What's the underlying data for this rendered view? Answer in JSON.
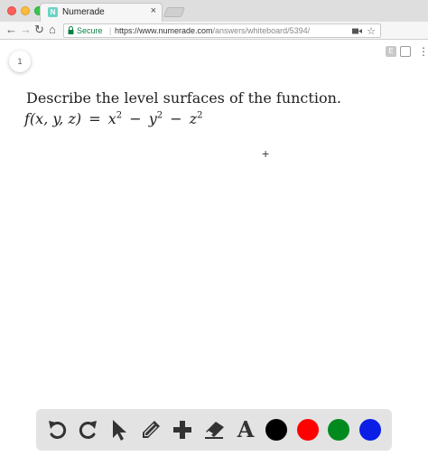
{
  "browser": {
    "tab_title": "Numerade",
    "favicon_letter": "N",
    "tab_close": "×",
    "secure_label": "Secure",
    "separator": "|",
    "url_base": "https://www.numerade.com",
    "url_path": "/answers/whiteboard/5394/",
    "nav_icons": [
      "back-arrow-icon",
      "forward-arrow-icon",
      "reload-icon",
      "home-icon"
    ],
    "back_glyph": "←",
    "forward_glyph": "→",
    "reload_glyph": "↻",
    "home_glyph": "⌂",
    "star_glyph": "☆",
    "menu_glyph": "⋮",
    "ext_letter": "E"
  },
  "whiteboard": {
    "page_number": "1",
    "question_text": "Describe the level surfaces of the function.",
    "formula": {
      "lhs": "f(x, y, z)",
      "eq": "=",
      "t1": "x",
      "t2": "y",
      "t3": "z",
      "exp": "2",
      "minus": "−"
    },
    "crosshair": "+"
  },
  "draw_toolbar": {
    "tools": [
      "undo-icon",
      "redo-icon",
      "pointer-icon",
      "pencil-icon",
      "plus-icon",
      "eraser-icon",
      "text-icon"
    ],
    "text_tool_label": "A",
    "colors": {
      "black": "#000000",
      "red": "#ff0000",
      "green": "#008a1e",
      "blue": "#0a1ee6"
    }
  }
}
